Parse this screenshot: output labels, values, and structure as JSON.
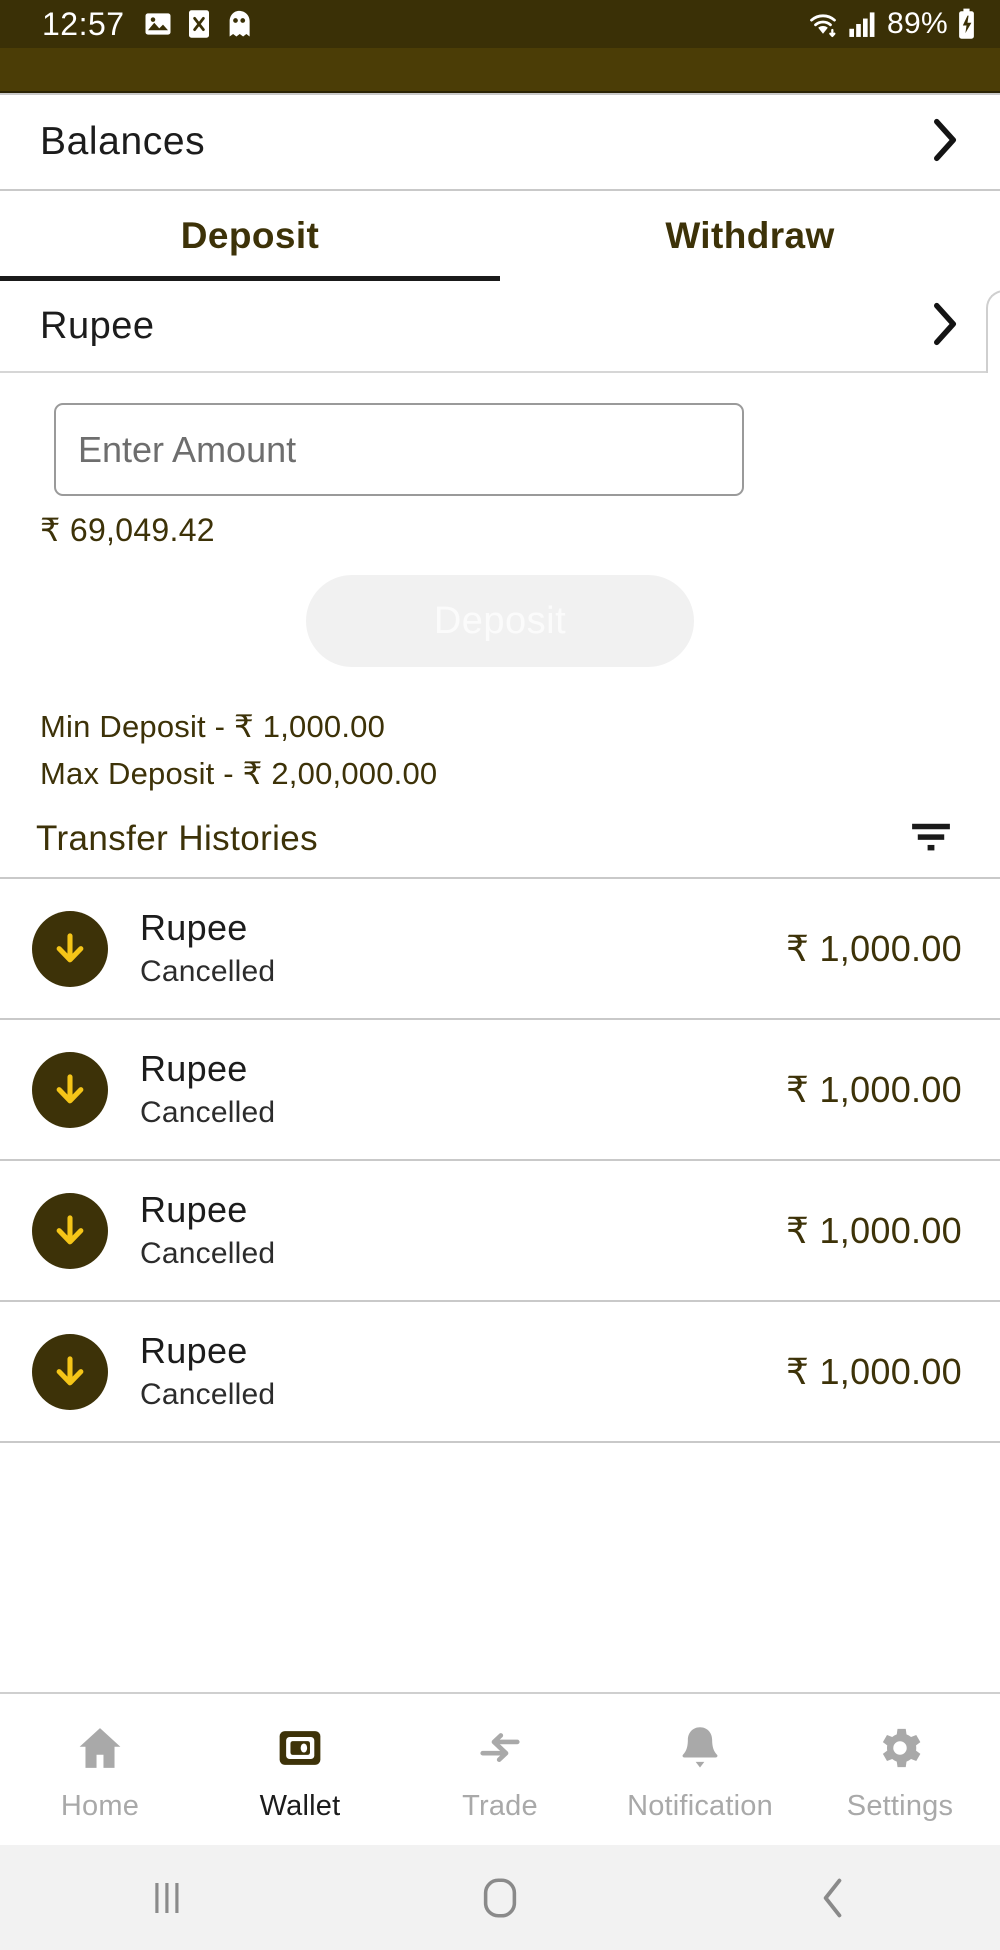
{
  "status_bar": {
    "time": "12:57",
    "battery_percent": "89%",
    "icons": [
      "image-icon",
      "x-file-icon",
      "ghost-icon",
      "wifi-icon",
      "cellular-signal-icon",
      "battery-charging-icon"
    ],
    "background_color": "#3a3006"
  },
  "header": {
    "title": "Balances",
    "chevron": "chevron-right-icon"
  },
  "tabs": [
    {
      "label": "Deposit",
      "active": true
    },
    {
      "label": "Withdraw",
      "active": false
    }
  ],
  "currency_selector": {
    "label": "Rupee",
    "chevron": "chevron-right-icon"
  },
  "form": {
    "amount_placeholder": "Enter Amount",
    "amount_value": "",
    "available_balance": "₹ 69,049.42",
    "submit_label": "Deposit",
    "submit_disabled": true,
    "min_deposit": "Min Deposit -  ₹ 1,000.00",
    "max_deposit": "Max Deposit -  ₹ 2,00,000.00"
  },
  "transfer_histories": {
    "title": "Transfer Histories",
    "filter_icon": "filter-icon",
    "rows": [
      {
        "title": "Rupee",
        "status": "Cancelled",
        "amount": "₹ 1,000.00",
        "direction": "arrow-down-icon"
      },
      {
        "title": "Rupee",
        "status": "Cancelled",
        "amount": "₹ 1,000.00",
        "direction": "arrow-down-icon"
      },
      {
        "title": "Rupee",
        "status": "Cancelled",
        "amount": "₹ 1,000.00",
        "direction": "arrow-down-icon"
      },
      {
        "title": "Rupee",
        "status": "Cancelled",
        "amount": "₹ 1,000.00",
        "direction": "arrow-down-icon"
      }
    ]
  },
  "bottom_nav": [
    {
      "label": "Home",
      "icon": "home-icon",
      "active": false
    },
    {
      "label": "Wallet",
      "icon": "wallet-icon",
      "active": true
    },
    {
      "label": "Trade",
      "icon": "trade-arrows-icon",
      "active": false
    },
    {
      "label": "Notification",
      "icon": "bell-icon",
      "active": false
    },
    {
      "label": "Settings",
      "icon": "gear-icon",
      "active": false
    }
  ],
  "system_nav": {
    "recents": "recents-icon",
    "home": "home-square-icon",
    "back": "back-chevron-icon"
  },
  "colors": {
    "brand_dark": "#3d3208",
    "accent_gold": "#f5c518",
    "status_bar_bg": "#3a3006",
    "inactive_gray": "#a9a9a9",
    "divider": "#c9c9c9"
  }
}
